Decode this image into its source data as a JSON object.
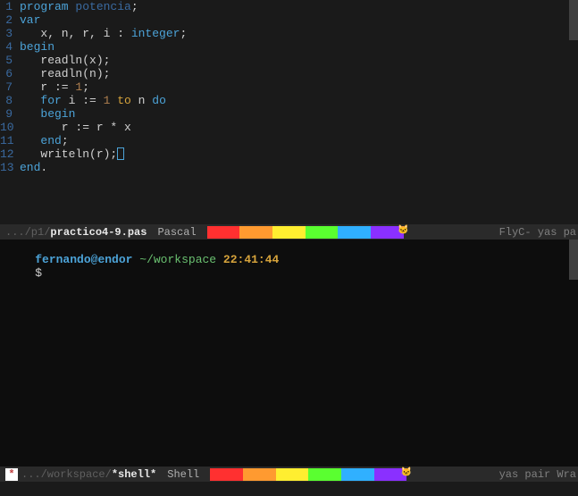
{
  "editor": {
    "lines": [
      {
        "n": 1,
        "tokens": [
          [
            "kw",
            "program"
          ],
          [
            "op",
            " "
          ],
          [
            "fn",
            "potencia"
          ],
          [
            "op",
            ";"
          ]
        ]
      },
      {
        "n": 2,
        "tokens": [
          [
            "kw",
            "var"
          ]
        ]
      },
      {
        "n": 3,
        "tokens": [
          [
            "op",
            "   x, n, r, i : "
          ],
          [
            "ty",
            "integer"
          ],
          [
            "op",
            ";"
          ]
        ]
      },
      {
        "n": 4,
        "tokens": [
          [
            "kw",
            "begin"
          ]
        ]
      },
      {
        "n": 5,
        "tokens": [
          [
            "op",
            "   readln(x);"
          ]
        ]
      },
      {
        "n": 6,
        "tokens": [
          [
            "op",
            "   readln(n);"
          ]
        ]
      },
      {
        "n": 7,
        "tokens": [
          [
            "op",
            "   r := "
          ],
          [
            "num",
            "1"
          ],
          [
            "op",
            ";"
          ]
        ]
      },
      {
        "n": 8,
        "tokens": [
          [
            "op",
            "   "
          ],
          [
            "kw",
            "for"
          ],
          [
            "op",
            " i := "
          ],
          [
            "num",
            "1"
          ],
          [
            "op",
            " "
          ],
          [
            "kw2",
            "to"
          ],
          [
            "op",
            " n "
          ],
          [
            "kw",
            "do"
          ]
        ]
      },
      {
        "n": 9,
        "tokens": [
          [
            "op",
            "   "
          ],
          [
            "kw",
            "begin"
          ]
        ]
      },
      {
        "n": 10,
        "tokens": [
          [
            "op",
            "      r := r * x"
          ]
        ]
      },
      {
        "n": 11,
        "tokens": [
          [
            "op",
            "   "
          ],
          [
            "kw",
            "end"
          ],
          [
            "op",
            ";"
          ]
        ]
      },
      {
        "n": 12,
        "tokens": [
          [
            "op",
            "   writeln(r);"
          ],
          [
            "cursor",
            ""
          ]
        ]
      },
      {
        "n": 13,
        "tokens": [
          [
            "kw",
            "end"
          ],
          [
            "op",
            "."
          ]
        ]
      }
    ]
  },
  "modeline_top": {
    "path": ".../p1/",
    "file": "practico4-9.pas",
    "mode": "Pascal",
    "right": "FlyC- yas pa"
  },
  "modeline_bottom": {
    "modified": "*",
    "path": ".../workspace/",
    "file": "*shell*",
    "mode": "Shell",
    "right": "yas pair Wra"
  },
  "shell": {
    "user": "fernando",
    "at": "@",
    "host": "endor",
    "cwd": "~/workspace",
    "time": "22:41:44",
    "prompt": "$"
  },
  "nyan": {
    "colors": [
      "#ff3030",
      "#ff9a30",
      "#ffee30",
      "#5aff30",
      "#30b0ff",
      "#8a30ff"
    ],
    "cat": "🐱"
  }
}
